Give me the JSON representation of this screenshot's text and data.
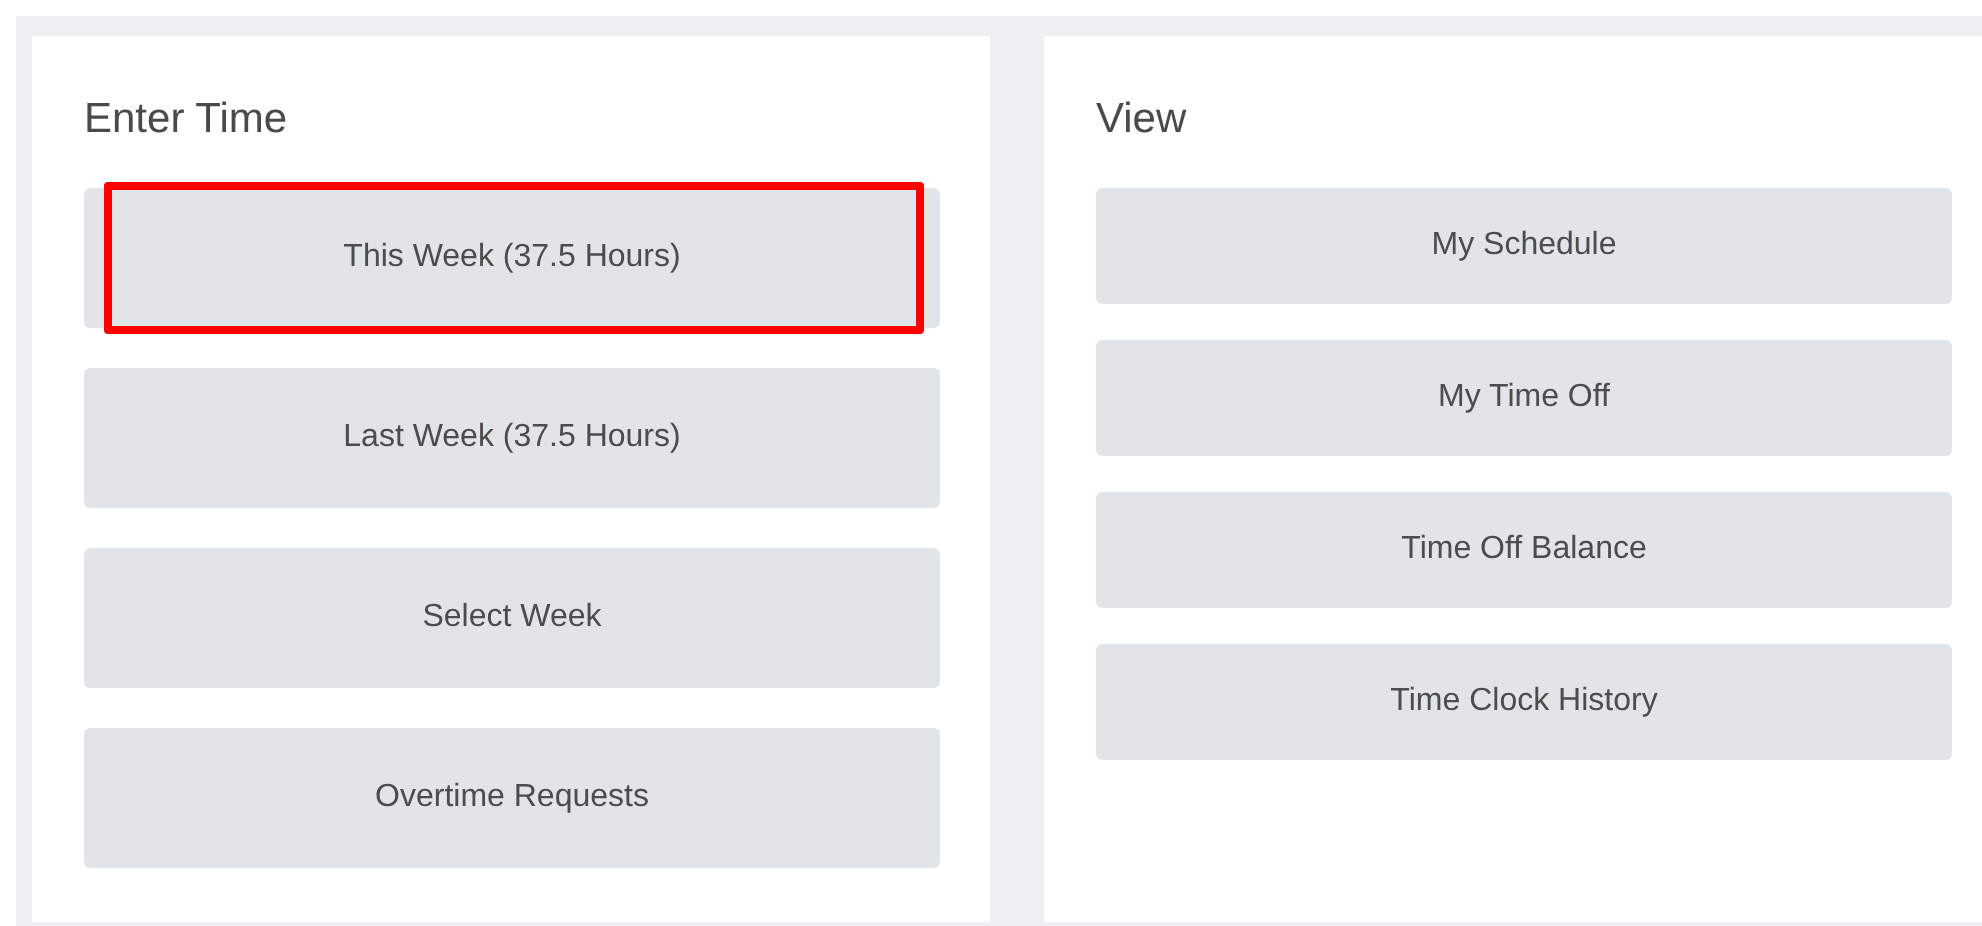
{
  "panels": [
    {
      "title": "Enter Time",
      "buttons": [
        {
          "label": "This Week (37.5 Hours)",
          "highlighted": true
        },
        {
          "label": "Last Week (37.5 Hours)",
          "highlighted": false
        },
        {
          "label": "Select Week",
          "highlighted": false
        },
        {
          "label": "Overtime Requests",
          "highlighted": false
        }
      ]
    },
    {
      "title": "View",
      "buttons": [
        {
          "label": "My Schedule",
          "highlighted": false
        },
        {
          "label": "My Time Off",
          "highlighted": false
        },
        {
          "label": "Time Off Balance",
          "highlighted": false
        },
        {
          "label": "Time Clock History",
          "highlighted": false
        }
      ]
    }
  ]
}
